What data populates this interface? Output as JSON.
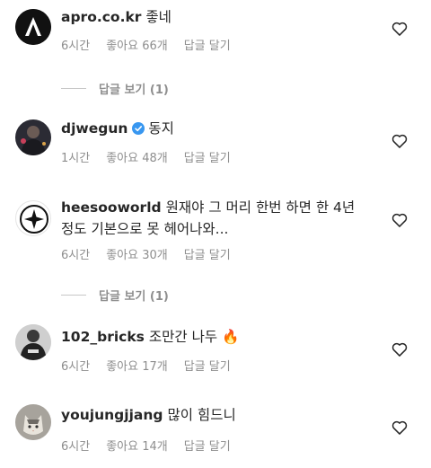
{
  "comments": [
    {
      "username": "apro.co.kr",
      "text": "좋네",
      "verified": false,
      "time": "6시간",
      "likes": "좋아요 66개",
      "reply": "답글 달기",
      "avatar_icon": "apro-logo-icon"
    },
    {
      "username": "djwegun",
      "text": "동지",
      "verified": true,
      "time": "1시간",
      "likes": "좋아요 48개",
      "reply": "답글 달기",
      "avatar_icon": "profile-photo"
    },
    {
      "username": "heesooworld",
      "text": "원재야 그 머리 한번 하면 한 4년정도 기본으로 못 헤어나와...",
      "verified": false,
      "time": "6시간",
      "likes": "좋아요 30개",
      "reply": "답글 달기",
      "avatar_icon": "star-logo-icon"
    },
    {
      "username": "102_bricks",
      "text": "조만간 나두 🔥",
      "verified": false,
      "time": "6시간",
      "likes": "좋아요 17개",
      "reply": "답글 달기",
      "avatar_icon": "profile-photo"
    },
    {
      "username": "youjungjjang",
      "text": "많이 힘드니",
      "verified": false,
      "time": "6시간",
      "likes": "좋아요 14개",
      "reply": "답글 달기",
      "avatar_icon": "cat-photo"
    }
  ],
  "view_replies": [
    {
      "label": "답글 보기 (1)"
    },
    {
      "label": "답글 보기 (1)"
    }
  ],
  "colors": {
    "text": "#262626",
    "secondary": "#8e8e8e",
    "verified": "#3897f0",
    "divider": "#c7c7c7"
  }
}
